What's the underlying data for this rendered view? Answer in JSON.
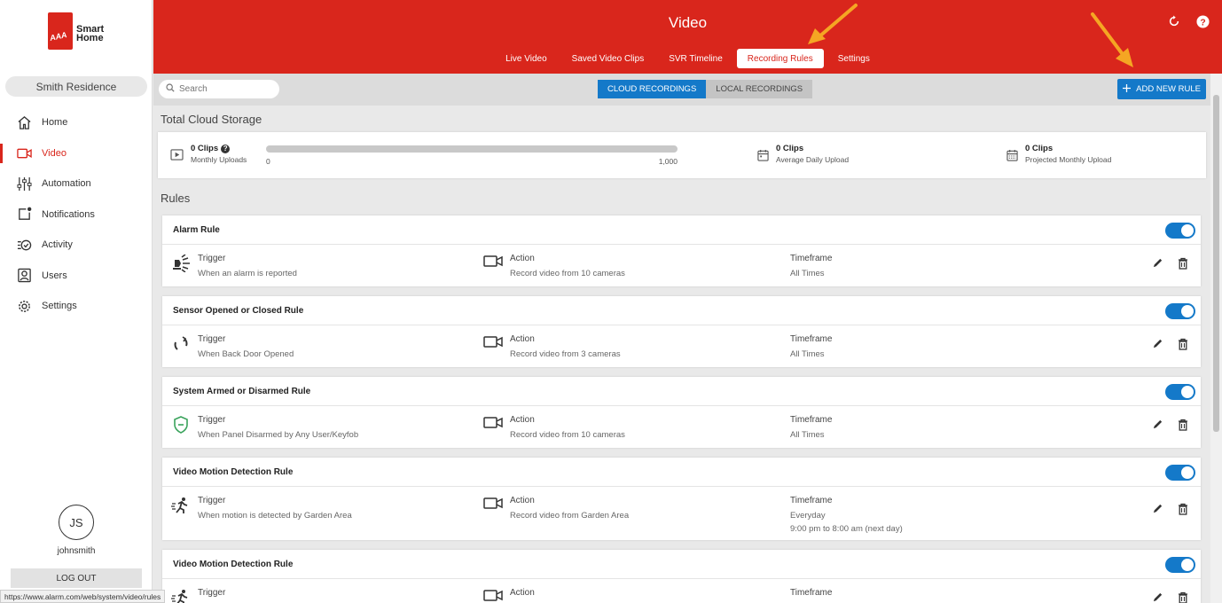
{
  "brand": {
    "line1": "Smart",
    "line2": "Home",
    "badge": "AAA"
  },
  "sidebar": {
    "residence": "Smith Residence",
    "items": [
      {
        "label": "Home",
        "icon": "home-icon",
        "active": false
      },
      {
        "label": "Video",
        "icon": "video-camera-icon",
        "active": true
      },
      {
        "label": "Automation",
        "icon": "sliders-icon",
        "active": false
      },
      {
        "label": "Notifications",
        "icon": "notification-icon",
        "active": false
      },
      {
        "label": "Activity",
        "icon": "activity-icon",
        "active": false
      },
      {
        "label": "Users",
        "icon": "user-icon",
        "active": false
      },
      {
        "label": "Settings",
        "icon": "gear-icon",
        "active": false
      }
    ],
    "avatar_initials": "JS",
    "username": "johnsmith",
    "logout_label": "LOG OUT"
  },
  "statusbar": {
    "url": "https://www.alarm.com/web/system/video/rules"
  },
  "header": {
    "title": "Video",
    "tabs": [
      {
        "label": "Live Video",
        "active": false
      },
      {
        "label": "Saved Video Clips",
        "active": false
      },
      {
        "label": "SVR Timeline",
        "active": false
      },
      {
        "label": "Recording Rules",
        "active": true
      },
      {
        "label": "Settings",
        "active": false
      }
    ]
  },
  "toolbar": {
    "search_placeholder": "Search",
    "segments": [
      {
        "label": "CLOUD RECORDINGS",
        "active": true
      },
      {
        "label": "LOCAL RECORDINGS",
        "active": false
      }
    ],
    "add_rule_label": "ADD NEW RULE"
  },
  "storage": {
    "title": "Total Cloud Storage",
    "monthly": {
      "value": "0 Clips",
      "label": "Monthly Uploads"
    },
    "bar": {
      "min": "0",
      "max": "1,000",
      "fill": 0
    },
    "daily": {
      "value": "0 Clips",
      "label": "Average Daily Upload"
    },
    "projected": {
      "value": "0 Clips",
      "label": "Projected Monthly Upload"
    }
  },
  "rules_title": "Rules",
  "rules": [
    {
      "name": "Alarm Rule",
      "enabled": true,
      "trigger_icon": "siren-icon",
      "trigger_label": "Trigger",
      "trigger": "When an alarm is reported",
      "action_label": "Action",
      "action": "Record video from 10 cameras",
      "timeframe_label": "Timeframe",
      "timeframe": "All Times",
      "timeframe_detail": ""
    },
    {
      "name": "Sensor Opened or Closed Rule",
      "enabled": true,
      "trigger_icon": "sensor-icon",
      "trigger_label": "Trigger",
      "trigger": "When Back Door Opened",
      "action_label": "Action",
      "action": "Record video from 3 cameras",
      "timeframe_label": "Timeframe",
      "timeframe": "All Times",
      "timeframe_detail": ""
    },
    {
      "name": "System Armed or Disarmed Rule",
      "enabled": true,
      "trigger_icon": "shield-icon",
      "trigger_label": "Trigger",
      "trigger": "When Panel Disarmed by Any User/Keyfob",
      "action_label": "Action",
      "action": "Record video from 10 cameras",
      "timeframe_label": "Timeframe",
      "timeframe": "All Times",
      "timeframe_detail": ""
    },
    {
      "name": "Video Motion Detection Rule",
      "enabled": true,
      "trigger_icon": "motion-icon",
      "trigger_label": "Trigger",
      "trigger": "When motion is detected by Garden Area",
      "action_label": "Action",
      "action": "Record video from Garden Area",
      "timeframe_label": "Timeframe",
      "timeframe": "Everyday",
      "timeframe_detail": "9:00 pm to 8:00 am (next day)"
    },
    {
      "name": "Video Motion Detection Rule",
      "enabled": true,
      "trigger_icon": "motion-icon",
      "trigger_label": "Trigger",
      "trigger": "",
      "action_label": "Action",
      "action": "",
      "timeframe_label": "Timeframe",
      "timeframe": "",
      "timeframe_detail": ""
    }
  ],
  "colors": {
    "brand_red": "#d9261c",
    "accent_blue": "#1479c9",
    "annotation_arrow": "#f5a623"
  }
}
